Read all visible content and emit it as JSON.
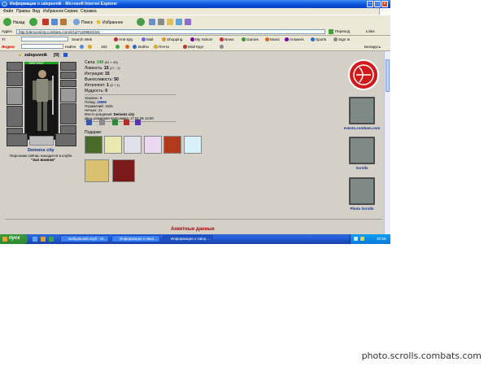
{
  "window": {
    "title": "Информация о zalepuvnik - Microsoft Internet Explorer"
  },
  "menu": [
    "Файл",
    "Правка",
    "Вид",
    "Избранное",
    "Сервис",
    "Справка"
  ],
  "toolbar": {
    "back": "Назад",
    "search": "Поиск",
    "favorites": "Избранное"
  },
  "address": {
    "label": "Адрес",
    "url": "http://demonscity.combats.com/inf.pl?1208524421",
    "go": "Переход",
    "links": "Links"
  },
  "toolbar2": {
    "search_web": "Search Web",
    "items": [
      "Anti-Spy",
      "Mail",
      "Shopping",
      "My Yahoo!",
      "News",
      "Games",
      "Music",
      "Answers",
      "Sports",
      "Sign In"
    ]
  },
  "toolbar3": {
    "brand": "Яндекс",
    "find": "Найти",
    "count": "192",
    "items": [
      "Войти",
      "Почта",
      "Мой Круг"
    ],
    "right": "Беларусь"
  },
  "character": {
    "name": "zalepuvnik",
    "level": "[9]",
    "hp": "1557/1557",
    "city": "Demons city",
    "location_note": "Персонаж сейчас находится в клубе.",
    "location_room": "\"Зал воинов\""
  },
  "stats": {
    "strength_label": "Сила:",
    "strength": "140",
    "strength_extra": "(91 + 49)",
    "agility_label": "Ловкость:",
    "agility": "15",
    "agility_extra": "(17 - 2)",
    "intuition_label": "Интуиция:",
    "intuition": "15",
    "endurance_label": "Выносливость:",
    "endurance": "50",
    "intellect_label": "Интеллект:",
    "intellect": "1",
    "intellect_extra": "(0 + 1)",
    "wisdom_label": "Мудрость:",
    "wisdom": "0"
  },
  "info": {
    "level_label": "Уровень:",
    "level": "9",
    "wins_label": "Побед:",
    "wins": "16990",
    "losses_label": "Поражений:",
    "losses": "1626",
    "draws_label": "Ничьих:",
    "draws": "21",
    "birthplace_label": "Место рождения:",
    "birthplace": "Demons city",
    "birthdate_label": "День рождения персонажа:",
    "birthdate": "17.01.06 14:00"
  },
  "gifts_label": "Подарки:",
  "sidebar": {
    "link1": "events.combats.com",
    "link2": "Scrolls",
    "link3": "Photo Scrolls"
  },
  "footer_heading": "Анкетные данные",
  "taskbar": {
    "start": "пуск",
    "tasks": [
      "Бойцовский клуб - M...",
      "Информация о нико...",
      "Информация о zalep..."
    ],
    "clock": "20:56"
  },
  "watermark": "photo.scrolls.combats.com",
  "colors": {
    "accent_green": "#1a8c1a",
    "link_navy": "#0b2f8a",
    "heading_red": "#b00000",
    "xp_blue": "#0a4fd8"
  }
}
